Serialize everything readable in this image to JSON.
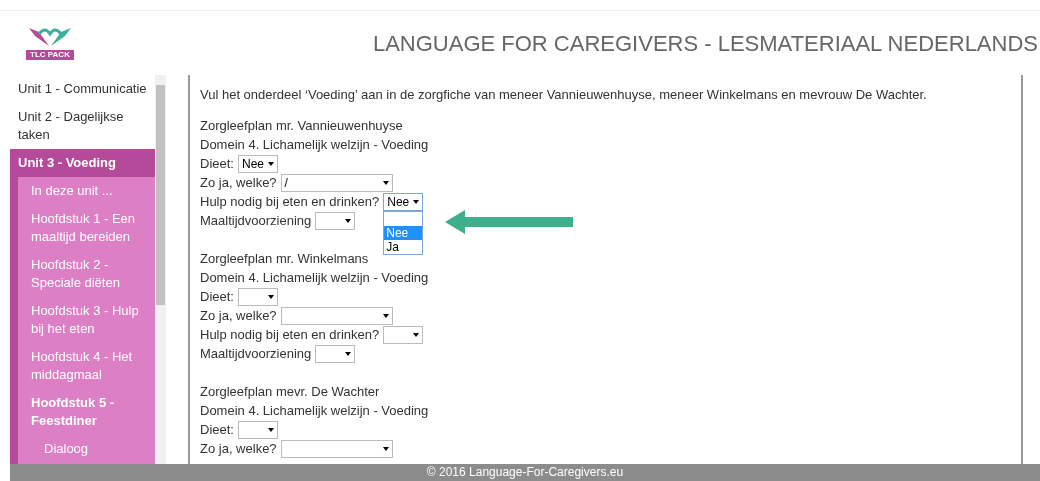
{
  "header": {
    "title": "LANGUAGE FOR CAREGIVERS - LESMATERIAAL NEDERLANDS",
    "logo_text": "TLC PACK"
  },
  "sidebar": {
    "items": [
      {
        "label": "Unit 1 - Communicatie",
        "selected": false
      },
      {
        "label": "Unit 2 - Dagelijkse taken",
        "selected": false
      },
      {
        "label": "Unit 3 - Voeding",
        "selected": true,
        "children": [
          {
            "label": "In deze unit ...",
            "selected": false
          },
          {
            "label": "Hoofdstuk 1 - Een maaltijd bereiden",
            "selected": false
          },
          {
            "label": "Hoofdstuk 2 - Speciale diëten",
            "selected": false
          },
          {
            "label": "Hoofdstuk 3 - Hulp bij het eten",
            "selected": false
          },
          {
            "label": "Hoofdstuk 4 - Het middagmaal",
            "selected": false
          },
          {
            "label": "Hoofdstuk 5 - Feestdiner",
            "selected": true,
            "children": [
              {
                "label": "Dialoog",
                "selected": false
              }
            ]
          }
        ]
      }
    ]
  },
  "instruction": "Vul het onderdeel ‘Voeding’ aan in de zorgfiche van meneer Vannieuwenhuyse, meneer Winkelmans en mevrouw De Wachter.",
  "sections": [
    {
      "title": "Zorgleefplan mr. Vannieuwenhuyse",
      "domain": "Domein 4. Lichamelijk welzijn - Voeding",
      "fields": [
        {
          "label": "Dieet:",
          "kind": "narrow",
          "value": "Nee",
          "open": false
        },
        {
          "label": "Zo ja, welke?",
          "kind": "wide",
          "value": "/",
          "open": false
        },
        {
          "label": "Hulp nodig bij eten en drinken?",
          "kind": "narrow",
          "value": "Nee",
          "open": true,
          "options": [
            {
              "label": "Nee",
              "selected": true
            },
            {
              "label": "Ja",
              "selected": false
            }
          ]
        },
        {
          "label": "Maaltijdvoorziening",
          "kind": "narrow",
          "open": false
        }
      ]
    },
    {
      "title": "Zorgleefplan mr. Winkelmans",
      "domain": "Domein 4. Lichamelijk welzijn - Voeding",
      "fields": [
        {
          "label": "Dieet:",
          "kind": "narrow",
          "open": false
        },
        {
          "label": "Zo ja, welke?",
          "kind": "wide",
          "open": false
        },
        {
          "label": "Hulp nodig bij eten en drinken?",
          "kind": "narrow",
          "open": false
        },
        {
          "label": "Maaltijdvoorziening",
          "kind": "narrow",
          "open": false
        }
      ]
    },
    {
      "title": "Zorgleefplan mevr. De Wachter",
      "domain": "Domein 4. Lichamelijk welzijn - Voeding",
      "fields": [
        {
          "label": "Dieet:",
          "kind": "narrow",
          "open": false
        },
        {
          "label": "Zo ja, welke?",
          "kind": "wide",
          "open": false
        }
      ]
    }
  ],
  "footer": "© 2016 Language-For-Caregivers.eu"
}
